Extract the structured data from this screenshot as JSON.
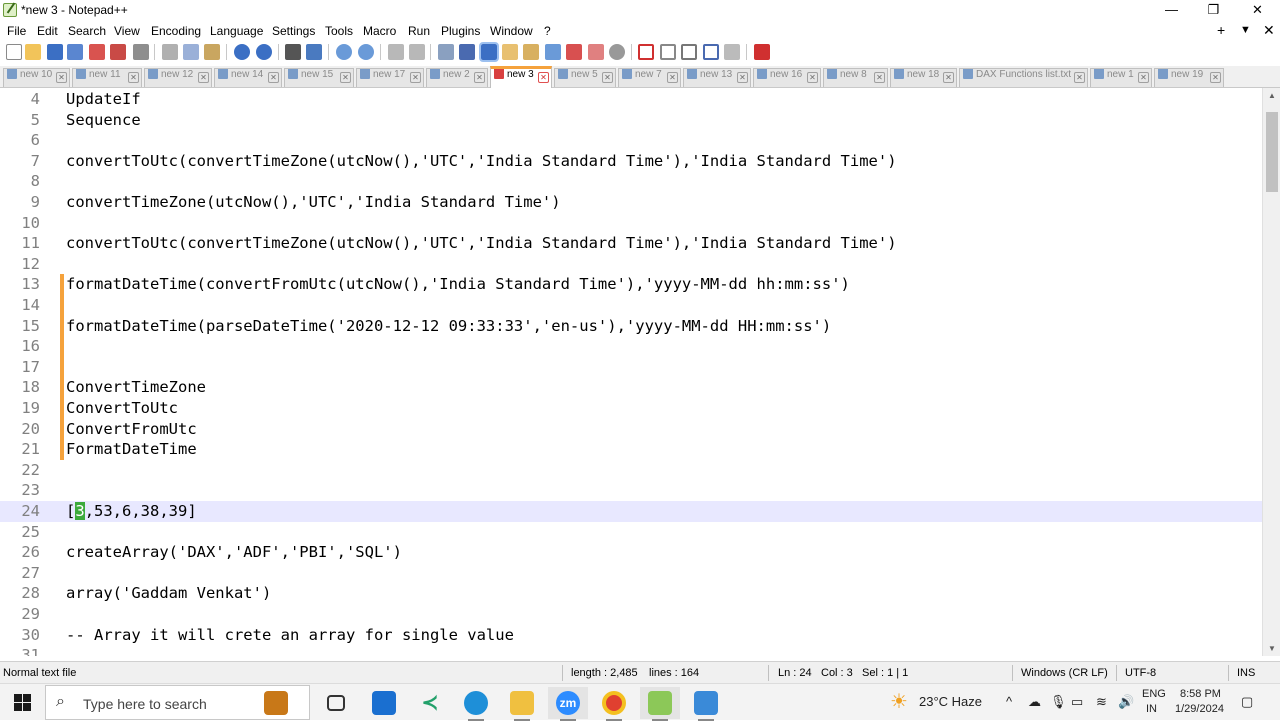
{
  "window": {
    "title": "*new 3 - Notepad++",
    "controls": {
      "minimize": "—",
      "restore": "❐",
      "close": "✕"
    }
  },
  "menu": {
    "items": [
      "File",
      "Edit",
      "Search",
      "View",
      "Encoding",
      "Language",
      "Settings",
      "Tools",
      "Macro",
      "Run",
      "Plugins",
      "Window",
      "?"
    ],
    "right": {
      "plus": "+",
      "dropdown": "▼",
      "close": "✕"
    }
  },
  "toolbar": {
    "icons": [
      "new-file-icon",
      "open-file-icon",
      "save-icon",
      "save-all-icon",
      "close-icon",
      "close-all-icon",
      "print-icon",
      "cut-icon",
      "copy-icon",
      "paste-icon",
      "undo-icon",
      "redo-icon",
      "find-icon",
      "replace-icon",
      "zoom-in-icon",
      "zoom-out-icon",
      "sync-vertical-icon",
      "sync-horizontal-icon",
      "word-wrap-icon",
      "show-all-chars-icon",
      "indent-guide-icon",
      "doc-map-icon",
      "doc-list-icon",
      "function-list-icon",
      "folder-workspace-icon",
      "monitoring-icon",
      "record-macro-icon",
      "stop-record-icon",
      "playback-icon",
      "run-macro-multiple-icon",
      "save-macro-icon",
      "spell-check-icon"
    ],
    "accent": "#3b6fc4"
  },
  "tabs": [
    {
      "label": "new 10",
      "active": false
    },
    {
      "label": "new 11",
      "active": false
    },
    {
      "label": "new 12",
      "active": false
    },
    {
      "label": "new 14",
      "active": false
    },
    {
      "label": "new 15",
      "active": false
    },
    {
      "label": "new 17",
      "active": false
    },
    {
      "label": "new 2",
      "active": false
    },
    {
      "label": "new 3",
      "active": true
    },
    {
      "label": "new 5",
      "active": false
    },
    {
      "label": "new 7",
      "active": false
    },
    {
      "label": "new 13",
      "active": false
    },
    {
      "label": "new 16",
      "active": false
    },
    {
      "label": "new 8",
      "active": false
    },
    {
      "label": "new 18",
      "active": false
    },
    {
      "label": "DAX Functions list.txt",
      "active": false
    },
    {
      "label": "new 1",
      "active": false
    },
    {
      "label": "new 19",
      "active": false
    }
  ],
  "editor": {
    "current_line": 24,
    "lines": [
      {
        "n": "4",
        "text": "UpdateIf",
        "changed": false
      },
      {
        "n": "5",
        "text": "Sequence",
        "changed": false
      },
      {
        "n": "6",
        "text": "",
        "changed": false
      },
      {
        "n": "7",
        "text": "convertToUtc(convertTimeZone(utcNow(),'UTC','India Standard Time'),'India Standard Time')",
        "changed": false
      },
      {
        "n": "8",
        "text": "",
        "changed": false
      },
      {
        "n": "9",
        "text": "convertTimeZone(utcNow(),'UTC','India Standard Time')",
        "changed": false
      },
      {
        "n": "10",
        "text": "",
        "changed": false
      },
      {
        "n": "11",
        "text": "convertToUtc(convertTimeZone(utcNow(),'UTC','India Standard Time'),'India Standard Time')",
        "changed": false
      },
      {
        "n": "12",
        "text": "",
        "changed": false
      },
      {
        "n": "13",
        "text": "formatDateTime(convertFromUtc(utcNow(),'India Standard Time'),'yyyy-MM-dd hh:mm:ss')",
        "changed": true
      },
      {
        "n": "14",
        "text": "",
        "changed": true
      },
      {
        "n": "15",
        "text": "formatDateTime(parseDateTime('2020-12-12 09:33:33','en-us'),'yyyy-MM-dd HH:mm:ss')",
        "changed": true
      },
      {
        "n": "16",
        "text": "",
        "changed": true
      },
      {
        "n": "17",
        "text": "",
        "changed": true
      },
      {
        "n": "18",
        "text": "ConvertTimeZone",
        "changed": true
      },
      {
        "n": "19",
        "text": "ConvertToUtc",
        "changed": true
      },
      {
        "n": "20",
        "text": "ConvertFromUtc",
        "changed": true
      },
      {
        "n": "21",
        "text": "FormatDateTime",
        "changed": true
      },
      {
        "n": "22",
        "text": "",
        "changed": false
      },
      {
        "n": "23",
        "text": "",
        "changed": false
      },
      {
        "n": "24",
        "text": "[3,53,6,38,39]",
        "changed": false
      },
      {
        "n": "25",
        "text": "",
        "changed": false
      },
      {
        "n": "26",
        "text": "createArray('DAX','ADF','PBI','SQL')",
        "changed": false
      },
      {
        "n": "27",
        "text": "",
        "changed": false
      },
      {
        "n": "28",
        "text": "array('Gaddam Venkat')",
        "changed": false
      },
      {
        "n": "29",
        "text": "",
        "changed": false
      },
      {
        "n": "30",
        "text": "-- Array it will crete an array for single value",
        "changed": false
      },
      {
        "n": "31",
        "text": "",
        "changed": false
      }
    ],
    "current_line_color": "#e8e8ff",
    "change_marker_color": "#f5a23c",
    "caret_color": "#3caa3c"
  },
  "status": {
    "file_type": "Normal text file",
    "length": "length : 2,485",
    "lines": "lines : 164",
    "ln": "Ln : 24",
    "col": "Col : 3",
    "sel": "Sel : 1 | 1",
    "eol": "Windows (CR LF)",
    "encoding": "UTF-8",
    "mode": "INS"
  },
  "taskbar": {
    "search_placeholder": "Type here to search",
    "apps": [
      "briefcase-icon",
      "task-view-icon",
      "mail-icon",
      "vscode-icon",
      "edge-icon",
      "file-explorer-icon",
      "zoom-icon",
      "chrome-icon",
      "notepadpp-icon",
      "paint-icon"
    ],
    "zoom_label": "zm",
    "weather": "23°C  Haze",
    "lang_top": "ENG",
    "lang_bottom": "IN",
    "time": "8:58 PM",
    "date": "1/29/2024",
    "tray_chevron": "^"
  }
}
